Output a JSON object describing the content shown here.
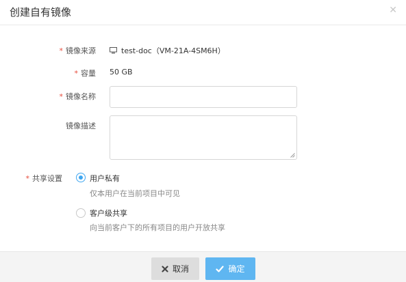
{
  "dialog": {
    "title": "创建自有镜像",
    "close_icon": "close-icon"
  },
  "form": {
    "source": {
      "label": "镜像来源",
      "required": true,
      "icon": "monitor-icon",
      "value": "test-doc（VM-21A-4SM6H）"
    },
    "capacity": {
      "label": "容量",
      "required": true,
      "value": "50 GB"
    },
    "name": {
      "label": "镜像名称",
      "required": true,
      "value": "",
      "placeholder": ""
    },
    "description": {
      "label": "镜像描述",
      "required": false,
      "value": "",
      "placeholder": ""
    },
    "share": {
      "label": "共享设置",
      "required": true,
      "options": [
        {
          "title": "用户私有",
          "desc": "仅本用户在当前项目中可见",
          "checked": true
        },
        {
          "title": "客户级共享",
          "desc": "向当前客户下的所有项目的用户开放共享",
          "checked": false
        }
      ]
    }
  },
  "footer": {
    "cancel_label": "取消",
    "cancel_icon": "x-icon",
    "ok_label": "确定",
    "ok_icon": "check-icon"
  },
  "colors": {
    "accent": "#3fa6f0",
    "primary_button": "#5fb6f1",
    "required": "#e74c3c",
    "footer_bg": "#f4f4f4"
  }
}
